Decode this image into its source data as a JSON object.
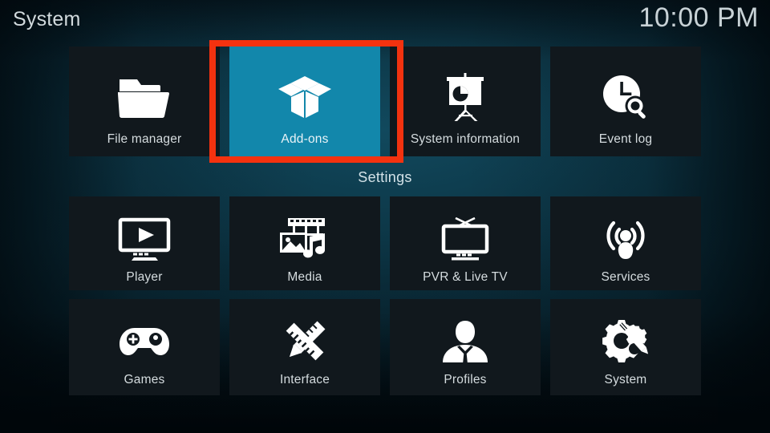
{
  "header": {
    "title": "System",
    "clock": "10:00 PM"
  },
  "divider": {
    "settings_label": "Settings"
  },
  "colors": {
    "selected_tile": "#1287ab",
    "tile_background": "#11181d",
    "annotation_red": "#f4320f",
    "text_primary": "#d5dcdf"
  },
  "top_row": [
    {
      "label": "File manager",
      "icon": "folder-icon",
      "selected": false
    },
    {
      "label": "Add-ons",
      "icon": "open-box-icon",
      "selected": true
    },
    {
      "label": "System information",
      "icon": "presentation-board-icon",
      "selected": false
    },
    {
      "label": "Event log",
      "icon": "clock-search-icon",
      "selected": false
    }
  ],
  "settings_rows": [
    [
      {
        "label": "Player",
        "icon": "monitor-play-icon"
      },
      {
        "label": "Media",
        "icon": "film-photo-music-icon"
      },
      {
        "label": "PVR & Live TV",
        "icon": "tv-antenna-icon"
      },
      {
        "label": "Services",
        "icon": "broadcast-person-icon"
      }
    ],
    [
      {
        "label": "Games",
        "icon": "gamepad-icon"
      },
      {
        "label": "Interface",
        "icon": "pencil-ruler-icon"
      },
      {
        "label": "Profiles",
        "icon": "person-bust-icon"
      },
      {
        "label": "System",
        "icon": "gears-screwdriver-icon"
      }
    ]
  ],
  "annotation": {
    "target": "Add-ons",
    "shape": "rectangle-highlight"
  }
}
